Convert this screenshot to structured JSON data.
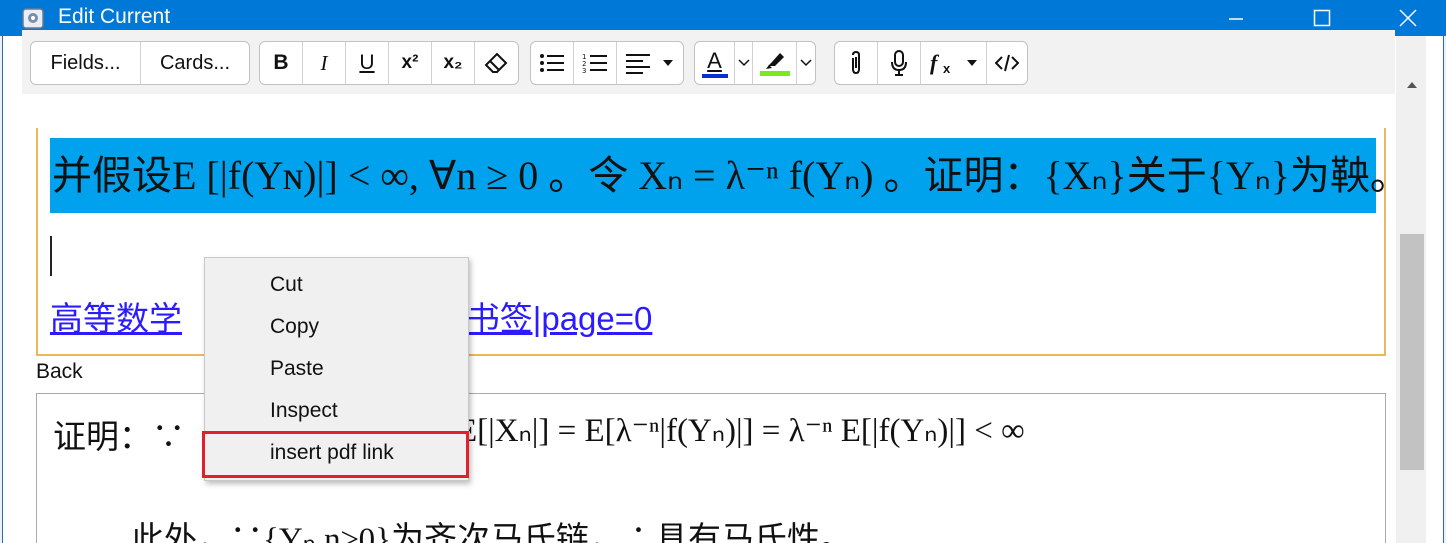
{
  "window": {
    "title": "Edit Current",
    "minimize_glyph": "—",
    "maximize_glyph": "☐",
    "close_glyph": "✕"
  },
  "toolbar": {
    "fields_label": "Fields...",
    "cards_label": "Cards...",
    "bold": "B",
    "italic": "I",
    "underline": "U",
    "superscript": "x²",
    "subscript": "x₂",
    "text_color": "A",
    "text_color_value": "#0a2fd6",
    "highlight_color_value": "#7ee81e"
  },
  "front": {
    "selected_text": "并假设E [|f(Yɴ)|] < ∞, ∀n ≥ 0 。令 Xₙ = λ⁻ⁿ f(Yₙ) 。证明：{Xₙ}关于{Yₙ}为鞅。",
    "link_text": "高等数学",
    "link_text_tail": "基2005_书签|page=0",
    "selection_color": "#00a2ed"
  },
  "back": {
    "label": "Back",
    "line1_head": "证明：∵",
    "line1_tail": "E[|Xₙ|] = E[λ⁻ⁿ|f(Yₙ)|] = λ⁻ⁿ E[|f(Yₙ)|] < ∞",
    "line2": "此外，∵{Yₙ,n≥0}为齐次马氏链，∴具有马氏性。"
  },
  "context_menu": {
    "items": [
      "Cut",
      "Copy",
      "Paste",
      "Inspect",
      "insert pdf link"
    ],
    "highlight_color": "#e0202a"
  }
}
